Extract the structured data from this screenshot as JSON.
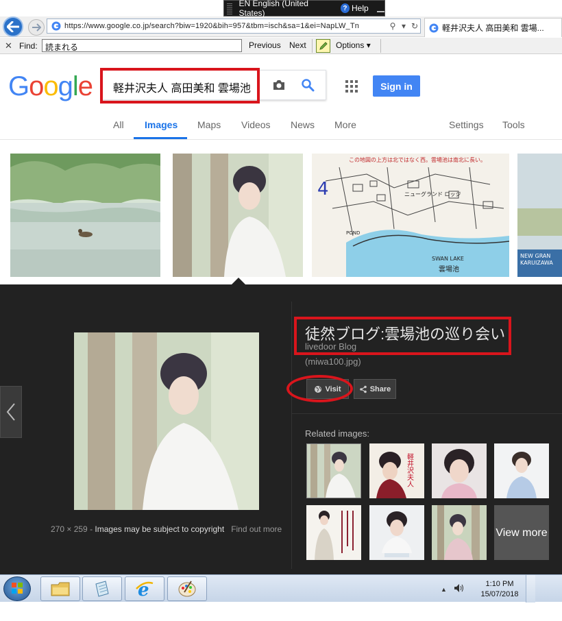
{
  "langbar": {
    "language": "EN English (United States)",
    "help": "Help"
  },
  "browser": {
    "url": "https://www.google.co.jp/search?biw=1920&bih=957&tbm=isch&sa=1&ei=NapLW_Tn",
    "tab_title": "軽井沢夫人 高田美和 雲場..."
  },
  "findbar": {
    "label": "Find:",
    "query": "読まれる",
    "previous": "Previous",
    "next": "Next",
    "options": "Options"
  },
  "google": {
    "logo": [
      "G",
      "o",
      "o",
      "g",
      "l",
      "e"
    ],
    "logo_colors": [
      "#4285f4",
      "#ea4335",
      "#fbbc05",
      "#4285f4",
      "#34a853",
      "#ea4335"
    ],
    "query": "軽井沢夫人 高田美和 雲場池",
    "signin": "Sign in",
    "tabs": [
      "All",
      "Images",
      "Maps",
      "Videos",
      "News",
      "More"
    ],
    "settings": "Settings",
    "tools": "Tools"
  },
  "thumbnails": [
    {
      "icon": "pond-photo"
    },
    {
      "icon": "woman-portrait-photo"
    },
    {
      "icon": "map-image",
      "caption_top": "この地図の上方は北ではなく西。雲場池は南北に長い。",
      "label_lodge": "ニューグランド ロッジ",
      "label_swan": "SWAN  LAKE",
      "label_pond": "雲場池",
      "label_pond_en": "POND"
    },
    {
      "icon": "karuizawa-sign-photo",
      "text_new": "NEW  GRAN",
      "text_karuizawa": "KARUIZAWA"
    }
  ],
  "preview": {
    "title": "徒然ブログ:雲場池の巡り会い",
    "source": "livedoor Blog",
    "filename": "(miwa100.jpg)",
    "visit": "Visit",
    "share": "Share",
    "dimensions": "270 × 259",
    "copyright": "Images may be subject to copyright",
    "find_out_more": "Find out more",
    "related_label": "Related images:",
    "view_more": "View more",
    "related_side_text": "軽井沢夫人"
  },
  "taskbar": {
    "time": "1:10 PM",
    "date": "15/07/2018"
  }
}
